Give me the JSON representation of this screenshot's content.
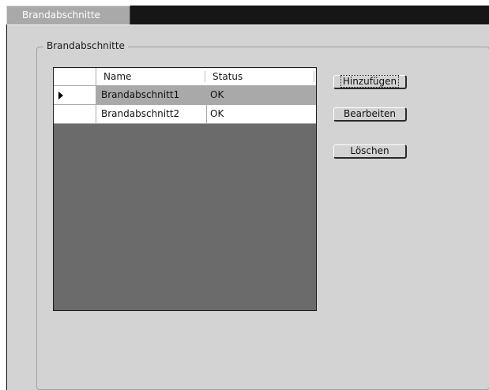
{
  "tab": {
    "label": "Brandabschnitte"
  },
  "groupbox": {
    "label": "Brandabschnitte"
  },
  "grid": {
    "columns": [
      "Name",
      "Status"
    ],
    "rows": [
      {
        "name": "Brandabschnitt1",
        "status": "OK",
        "selected": true
      },
      {
        "name": "Brandabschnitt2",
        "status": "OK",
        "selected": false
      }
    ]
  },
  "buttons": {
    "add": "Hinzufügen",
    "edit": "Bearbeiten",
    "delete": "Löschen"
  },
  "colors": {
    "panel": "#d3d3d3",
    "grid_background": "#6b6b6b",
    "selected_row": "#a9a9a9",
    "tab_strip": "#161616"
  },
  "icons": {
    "current_row": "triangle-right-icon"
  }
}
